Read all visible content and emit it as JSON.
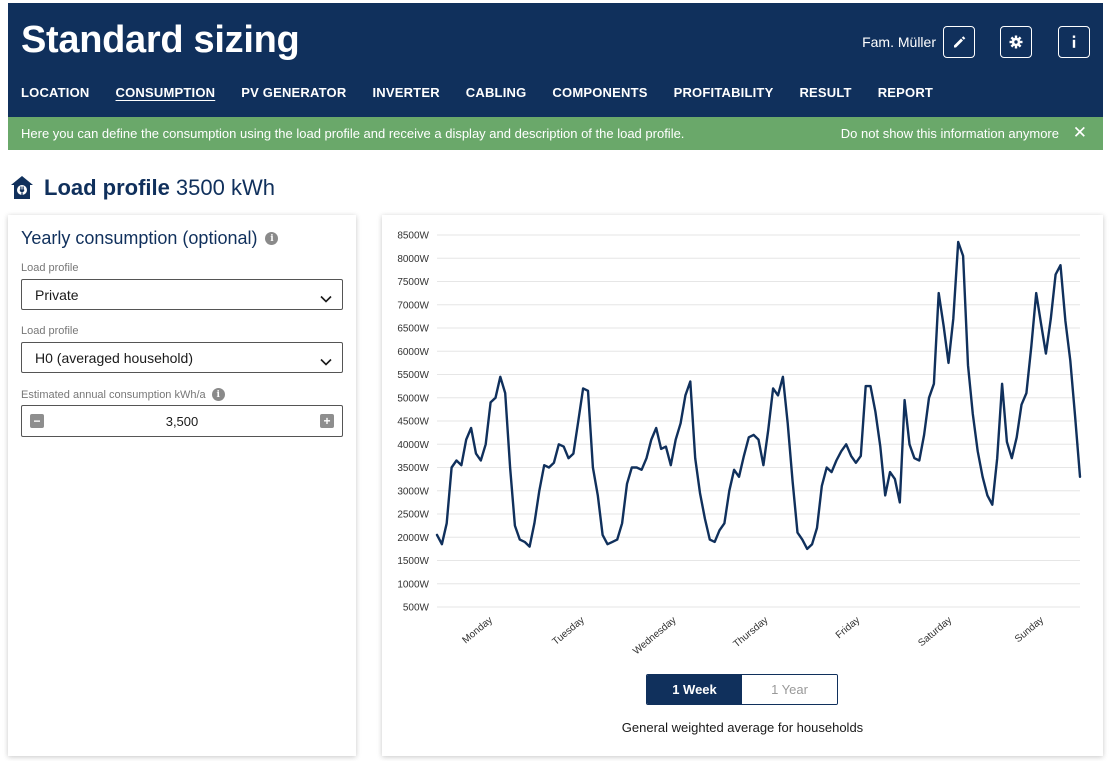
{
  "header": {
    "title": "Standard sizing",
    "user": "Fam. Müller",
    "edit_icon": "pencil-icon",
    "settings_icon": "gear-icon",
    "info_icon": "info-icon",
    "bg_color": "#10305c"
  },
  "nav": {
    "items": [
      {
        "label": "LOCATION",
        "active": false
      },
      {
        "label": "CONSUMPTION",
        "active": true
      },
      {
        "label": "PV GENERATOR",
        "active": false
      },
      {
        "label": "INVERTER",
        "active": false
      },
      {
        "label": "CABLING",
        "active": false
      },
      {
        "label": "COMPONENTS",
        "active": false
      },
      {
        "label": "PROFITABILITY",
        "active": false
      },
      {
        "label": "RESULT",
        "active": false
      },
      {
        "label": "REPORT",
        "active": false
      }
    ]
  },
  "banner": {
    "text": "Here you can define the consumption using the load profile and receive a display and description of the load profile.",
    "dismiss": "Do not show this information anymore",
    "close": "✕",
    "bg_color": "#6aa86a"
  },
  "page": {
    "title": "Load profile",
    "value": "3500 kWh",
    "icon": "house-plug-icon"
  },
  "left_panel": {
    "title": "Yearly consumption (optional)",
    "info_glyph": "i",
    "profile_label": "Load profile",
    "profile_value": "Private",
    "subprofile_label": "Load profile",
    "subprofile_value": "H0 (averaged household)",
    "annual_label": "Estimated annual consumption kWh/a",
    "annual_value": "3,500",
    "minus_glyph": "−",
    "plus_glyph": "+"
  },
  "chart_panel": {
    "toggle_week": "1 Week",
    "toggle_year": "1 Year",
    "active_toggle": "1 Week",
    "caption": "General weighted average for households"
  },
  "chart_data": {
    "type": "line",
    "title": "",
    "xlabel": "",
    "ylabel": "",
    "ylim": [
      500,
      8500
    ],
    "yticks": [
      "500W",
      "1000W",
      "1500W",
      "2000W",
      "2500W",
      "3000W",
      "3500W",
      "4000W",
      "4500W",
      "5000W",
      "5500W",
      "6000W",
      "6500W",
      "7000W",
      "7500W",
      "8000W",
      "8500W"
    ],
    "yvalues": [
      500,
      1000,
      1500,
      2000,
      2500,
      3000,
      3500,
      4000,
      4500,
      5000,
      5500,
      6000,
      6500,
      7000,
      7500,
      8000,
      8500
    ],
    "x_categories": [
      "Monday",
      "Tuesday",
      "Wednesday",
      "Thursday",
      "Friday",
      "Saturday",
      "Sunday"
    ],
    "grid": true,
    "line_color": "#10305c",
    "series": [
      {
        "values": [
          2050,
          1850,
          2300,
          3500,
          3650,
          3550,
          4100,
          4350,
          3800,
          3650,
          4000,
          4900,
          5000,
          5450,
          5100,
          3500,
          2250,
          1950,
          1900,
          1800,
          2300,
          3000,
          3550,
          3500,
          3600,
          4000,
          3950,
          3700,
          3800,
          4500,
          5200,
          5150,
          3500,
          2900,
          2050,
          1850,
          1900,
          1950,
          2300,
          3150,
          3500,
          3500,
          3450,
          3700,
          4100,
          4350,
          3900,
          3950,
          3550,
          4100,
          4450,
          5050,
          5350,
          3700,
          2950,
          2400,
          1950,
          1900,
          2150,
          2300,
          3000,
          3450,
          3300,
          3750,
          4150,
          4200,
          4100,
          3550,
          4300,
          5200,
          5050,
          5450,
          4450,
          3200,
          2100,
          1950,
          1750,
          1850,
          2200,
          3100,
          3500,
          3400,
          3650,
          3850,
          4000,
          3750,
          3600,
          3750,
          5250,
          5250,
          4700,
          3950,
          2900,
          3400,
          3250,
          2750,
          4950,
          4000,
          3700,
          3650,
          4200,
          5000,
          5300,
          7250,
          6550,
          5750,
          6700,
          8350,
          8050,
          5700,
          4650,
          3850,
          3300,
          2900,
          2700,
          3700,
          5300,
          4050,
          3700,
          4150,
          4850,
          5100,
          6100,
          7250,
          6600,
          5950,
          6700,
          7650,
          7850,
          6650,
          5800,
          4600,
          3300
        ]
      }
    ]
  }
}
